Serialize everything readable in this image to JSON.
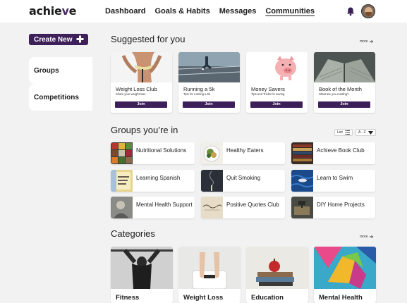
{
  "header": {
    "logo_main": "achie",
    "logo_accent": "v",
    "logo_end": "e",
    "nav": [
      "Dashboard",
      "Goals & Habits",
      "Messages",
      "Communities"
    ],
    "active_nav": "Communities"
  },
  "sidebar": {
    "create_label": "Create New",
    "items": [
      "Groups",
      "Competitions"
    ]
  },
  "suggested": {
    "title": "Suggested for you",
    "more": "more",
    "cards": [
      {
        "title": "Weight Loss Club",
        "subtitle": "Share your weight loss",
        "join": "Join"
      },
      {
        "title": "Running a 5k",
        "subtitle": "Tips for running a 5k",
        "join": "Join"
      },
      {
        "title": "Money Savers",
        "subtitle": "Tips and Tricks for saving",
        "join": "Join"
      },
      {
        "title": "Book of the Month",
        "subtitle": "What are you reading?",
        "join": "Join"
      }
    ]
  },
  "groups": {
    "title": "Groups you’re in",
    "view_label": "List",
    "sort_label": "A - Z",
    "items": [
      "Nutritional Solutions",
      "Healthy Eaters",
      "Achieve Book Club",
      "Learning Spanish",
      "Quit Smoking",
      "Learn to Swim",
      "Mental Health Support",
      "Positive Quotes Club",
      "DIY Home Projects"
    ]
  },
  "categories": {
    "title": "Categories",
    "more": "more",
    "items": [
      "Fitness",
      "Weight Loss",
      "Education",
      "Mental Health"
    ]
  },
  "colors": {
    "brand": "#3d1f5a",
    "background": "#f2f2f2"
  }
}
